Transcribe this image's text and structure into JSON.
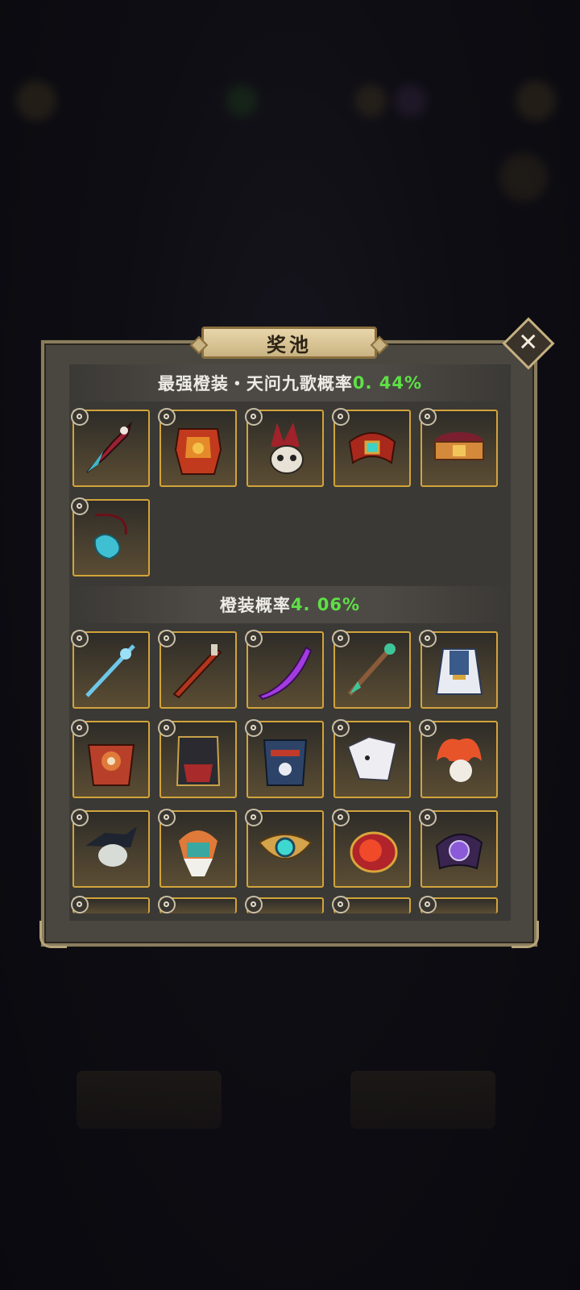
{
  "dialog": {
    "title": "奖池",
    "close_label": "✕"
  },
  "sections": [
    {
      "heading_prefix": "最强橙装・天问九歌概率",
      "heading_rate": "0. 44%",
      "items": [
        {
          "icon": "crimson-dagger-icon"
        },
        {
          "icon": "red-armor-icon"
        },
        {
          "icon": "skull-helmet-icon"
        },
        {
          "icon": "jade-bracer-icon"
        },
        {
          "icon": "gold-belt-icon"
        },
        {
          "icon": "dragon-amulet-icon"
        }
      ]
    },
    {
      "heading_prefix": "橙装概率",
      "heading_rate": "4. 06%",
      "items": [
        {
          "icon": "ice-spear-icon"
        },
        {
          "icon": "crimson-sword-icon"
        },
        {
          "icon": "purple-blade-icon"
        },
        {
          "icon": "jade-staff-icon"
        },
        {
          "icon": "blue-robe-icon"
        },
        {
          "icon": "lion-armor-icon"
        },
        {
          "icon": "dark-armor-icon"
        },
        {
          "icon": "navy-armor-icon"
        },
        {
          "icon": "white-beast-mask-icon"
        },
        {
          "icon": "flame-mask-icon"
        },
        {
          "icon": "horned-mask-icon"
        },
        {
          "icon": "lion-helm-icon"
        },
        {
          "icon": "turquoise-amulet-icon"
        },
        {
          "icon": "ruby-ring-icon"
        },
        {
          "icon": "violet-bracer-icon"
        }
      ]
    }
  ],
  "colors": {
    "rate_highlight": "#5ee046",
    "item_border": "#d1a43a"
  }
}
